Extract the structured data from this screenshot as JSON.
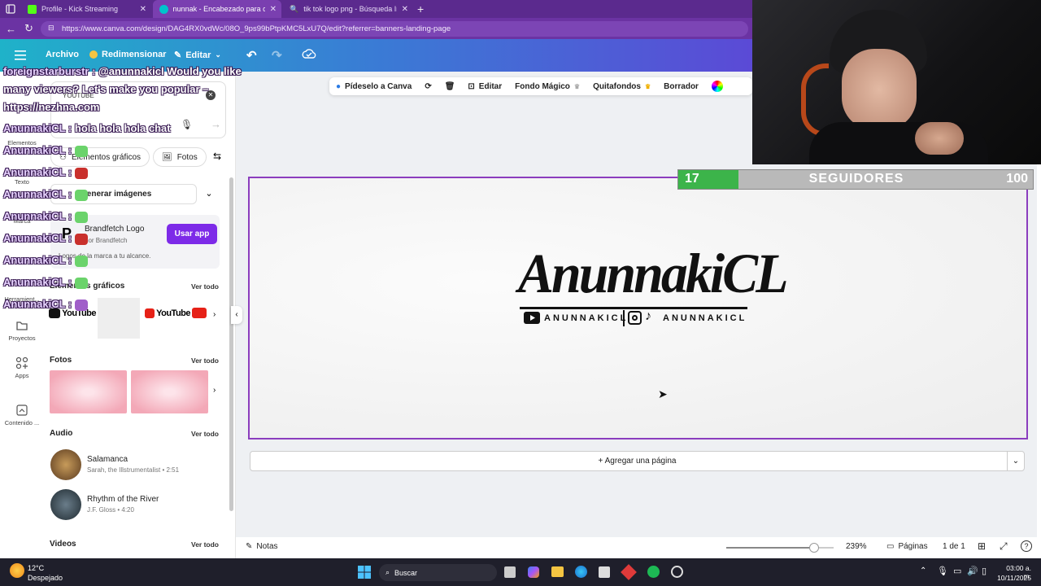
{
  "browser": {
    "tabs": [
      {
        "label": "Profile - Kick Streaming",
        "active": false
      },
      {
        "label": "nunnak - Encabezado para correo",
        "active": true
      },
      {
        "label": "tik tok logo png - Búsqueda Imá",
        "active": false
      }
    ],
    "url": "https://www.canva.com/design/DAG4RX0vdWc/08O_9ps99bPtpKMC5LxU7Q/edit?referrer=banners-landing-page"
  },
  "header": {
    "file": "Archivo",
    "resize": "Redimensionar",
    "edit": "Editar"
  },
  "rail": [
    {
      "label": "Elementos",
      "icon": "elements-icon"
    },
    {
      "label": "Texto",
      "icon": "text-icon"
    },
    {
      "label": "Marca",
      "icon": "brand-icon"
    },
    {
      "label": "Subir",
      "icon": "upload-icon"
    },
    {
      "label": "Herramient...",
      "icon": "tools-icon"
    },
    {
      "label": "Proyectos",
      "icon": "folder-icon"
    },
    {
      "label": "Apps",
      "icon": "apps-icon"
    },
    {
      "label": "Contenido ...",
      "icon": "content-icon"
    }
  ],
  "panel": {
    "search_value": "YOUTUBE",
    "chips": [
      "Elementos gráficos",
      "Fotos"
    ],
    "generate": "Generar imágenes",
    "app_card": {
      "title": "Brandfetch Logo",
      "by": "por Brandfetch",
      "desc": "Logos de la marca a tu alcance.",
      "button": "Usar app"
    },
    "graphics": {
      "title": "Elementos gráficos",
      "see_all": "Ver todo"
    },
    "photos": {
      "title": "Fotos",
      "see_all": "Ver todo"
    },
    "audio": {
      "title": "Audio",
      "see_all": "Ver todo",
      "tracks": [
        {
          "title": "Salamanca",
          "meta": "Sarah, the Illstrumentalist • 2:51"
        },
        {
          "title": "Rhythm of the River",
          "meta": "J.F. Gloss • 4:20"
        }
      ]
    },
    "videos": {
      "title": "Videos",
      "see_all": "Ver todo"
    }
  },
  "context_bar": {
    "ask": "Pídeselo a Canva",
    "edit": "Editar",
    "magic_bg": "Fondo Mágico",
    "remove_bg": "Quitafondos",
    "eraser": "Borrador"
  },
  "design": {
    "title": "AnunnakiCL",
    "handle_youtube": "ANUNNAKICL",
    "handle_social": "ANUNNAKICL"
  },
  "add_page": "+ Agregar una página",
  "footer": {
    "notes": "Notas",
    "zoom": "239%",
    "zoom_level": 0.82,
    "pages": "Páginas",
    "page_count": "1 de 1"
  },
  "taskbar": {
    "temp": "12°C",
    "weather": "Despejado",
    "search": "Buscar",
    "time": "03:00 a. m.",
    "date": "10/11/2025"
  },
  "chat": [
    {
      "name": "foreignstarburstr :",
      "msg": " @anunnakicl Would you like"
    },
    {
      "name": "",
      "msg": "many viewers? Let's make you popular –"
    },
    {
      "name": "",
      "msg": "https://nezhna.com"
    },
    {
      "name": "AnunnakiCL :",
      "msg": " hola hola hola chat"
    },
    {
      "name": "AnunnakiCL :",
      "msg": ""
    },
    {
      "name": "AnunnakiCL :",
      "msg": ""
    },
    {
      "name": "AnunnakiCL :",
      "msg": ""
    },
    {
      "name": "AnunnakiCL :",
      "msg": ""
    },
    {
      "name": "AnunnakiCL :",
      "msg": ""
    },
    {
      "name": "AnunnakiCL :",
      "msg": ""
    },
    {
      "name": "AnunnakiCL :",
      "msg": ""
    },
    {
      "name": "AnunnakiCL :",
      "msg": ""
    }
  ],
  "follow_goal": {
    "current": "17",
    "label": "SEGUIDORES",
    "target": "100",
    "progress": 0.17
  },
  "colors": {
    "accent": "#8b3dbe",
    "goal_green": "#3cb44a",
    "usar_app": "#7d2ae8"
  }
}
